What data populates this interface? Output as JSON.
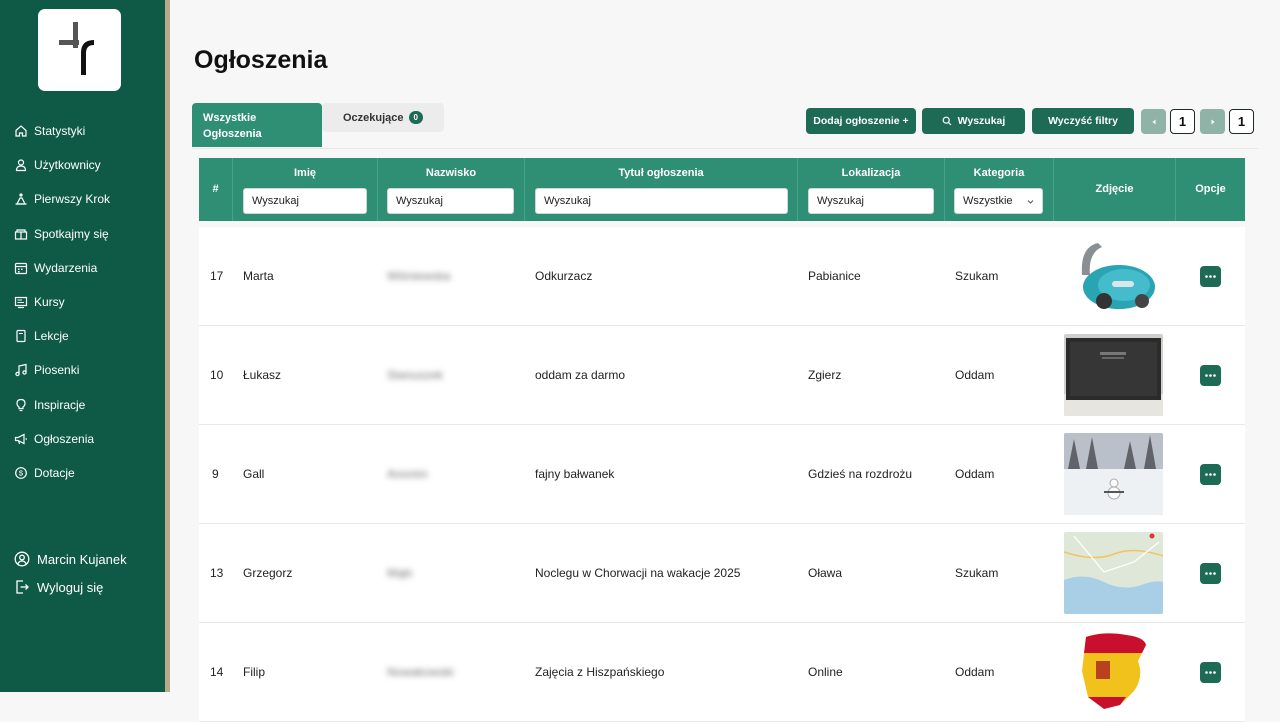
{
  "sidebar": {
    "items": [
      {
        "label": "Statystyki",
        "icon": "home-icon"
      },
      {
        "label": "Użytkownicy",
        "icon": "user-icon"
      },
      {
        "label": "Pierwszy Krok",
        "icon": "steps-icon"
      },
      {
        "label": "Spotkajmy się",
        "icon": "meet-icon"
      },
      {
        "label": "Wydarzenia",
        "icon": "calendar-icon"
      },
      {
        "label": "Kursy",
        "icon": "course-icon"
      },
      {
        "label": "Lekcje",
        "icon": "lesson-icon"
      },
      {
        "label": "Piosenki",
        "icon": "music-icon"
      },
      {
        "label": "Inspiracje",
        "icon": "bulb-icon"
      },
      {
        "label": "Ogłoszenia",
        "icon": "megaphone-icon"
      },
      {
        "label": "Dotacje",
        "icon": "coin-icon"
      }
    ],
    "user_name": "Marcin Kujanek",
    "logout_label": "Wyloguj się"
  },
  "page": {
    "title": "Ogłoszenia"
  },
  "tabs": {
    "all_label": "Wszystkie Ogłoszenia",
    "pending_label": "Oczekujące",
    "pending_count": "0"
  },
  "toolbar": {
    "add_label": "Dodaj ogłoszenie +",
    "search_label": "Wyszukaj",
    "clear_label": "Wyczyść filtry",
    "current_page": "1",
    "total_pages": "1"
  },
  "table": {
    "columns": {
      "num": "#",
      "first_name": "Imię",
      "last_name": "Nazwisko",
      "title": "Tytuł ogłoszenia",
      "location": "Lokalizacja",
      "category": "Kategoria",
      "photo": "Zdjęcie",
      "options": "Opcje"
    },
    "filters": {
      "first_name": "Wyszukaj",
      "last_name": "Wyszukaj",
      "title": "Wyszukaj",
      "location": "Wyszukaj",
      "category": "Wszystkie"
    },
    "rows": [
      {
        "id": "17",
        "first_name": "Marta",
        "last_name": "Wiśniewska",
        "title": "Odkurzacz",
        "location": "Pabianice",
        "category": "Szukam",
        "photo": "vacuum-photo"
      },
      {
        "id": "10",
        "first_name": "Łukasz",
        "last_name": "Stanuszek",
        "title": "oddam za darmo",
        "location": "Zgierz",
        "category": "Oddam",
        "photo": "mat-photo"
      },
      {
        "id": "9",
        "first_name": "Gall",
        "last_name": "Anonim",
        "title": "fajny bałwanek",
        "location": "Gdzieś na rozdrożu",
        "category": "Oddam",
        "photo": "snowman-photo"
      },
      {
        "id": "13",
        "first_name": "Grzegorz",
        "last_name": "Mąki",
        "title": "Noclegu w Chorwacji na wakacje 2025",
        "location": "Oława",
        "category": "Szukam",
        "photo": "map-photo"
      },
      {
        "id": "14",
        "first_name": "Filip",
        "last_name": "Nowakowski",
        "title": "Zajęcia z Hiszpańskiego",
        "location": "Online",
        "category": "Oddam",
        "photo": "spain-flag-map-photo"
      }
    ]
  }
}
